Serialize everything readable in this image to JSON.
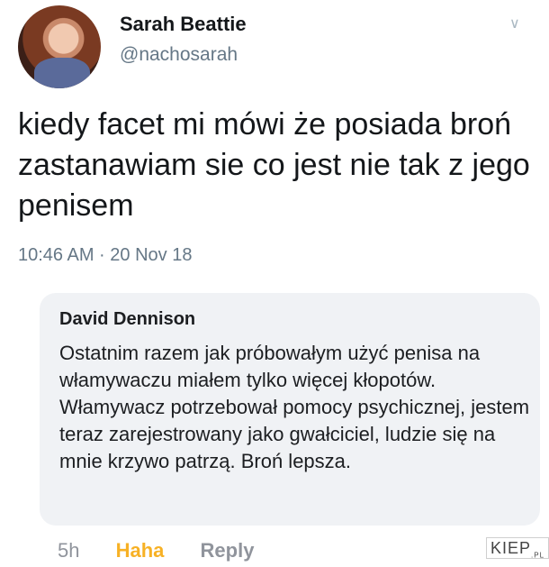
{
  "tweet": {
    "name": "Sarah Beattie",
    "handle": "@nachosarah",
    "text": "kiedy facet mi mówi że posiada broń zastanawiam sie co jest nie tak z jego penisem",
    "meta": "10:46 AM · 20 Nov 18",
    "menu_icon": "chevron-down-icon"
  },
  "comment": {
    "name": "David Dennison",
    "text": "Ostatnim razem jak próbowałym użyć penisa na włamywaczu miałem tylko więcej kłopotów. Włamywacz potrzebował pomocy psychicznej, jestem teraz zarejestrowany jako gwałciciel, ludzie się na mnie krzywo patrzą. Broń lepsza.",
    "time": "5h",
    "reaction": "Haha",
    "reply_label": "Reply"
  },
  "watermark": {
    "text": "KIEP",
    "suffix": ".PL"
  }
}
